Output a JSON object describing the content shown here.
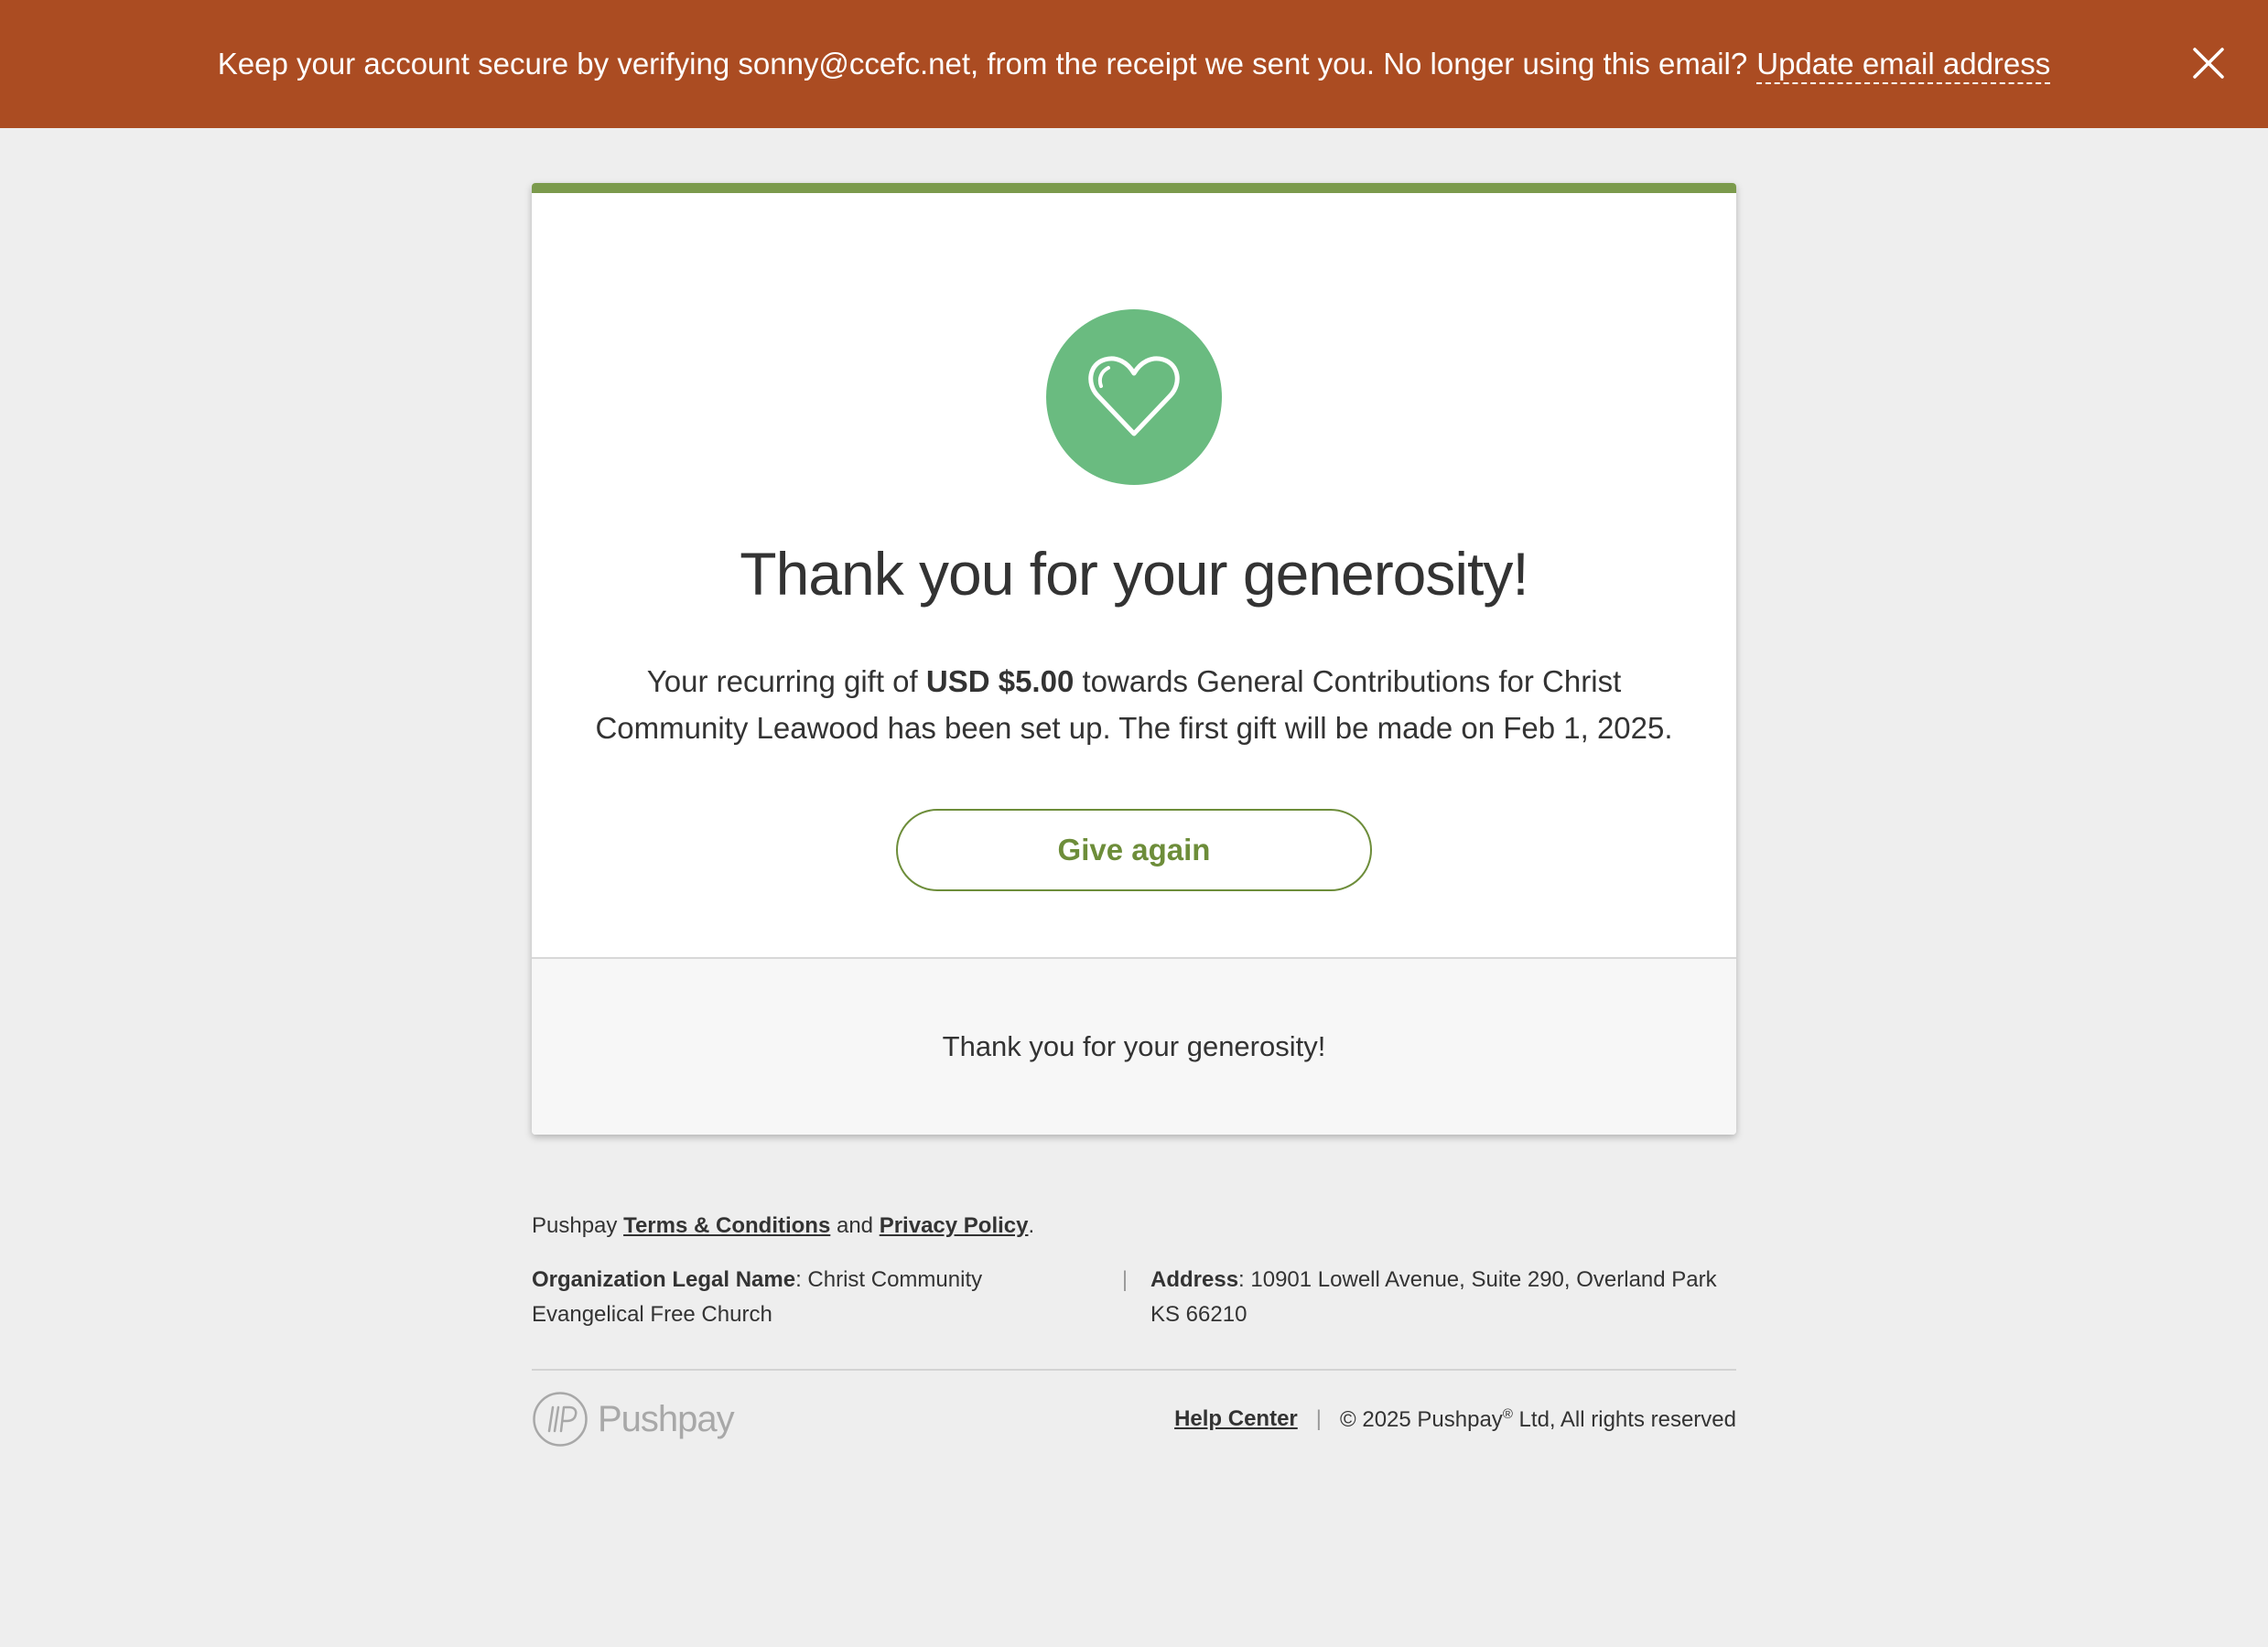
{
  "banner": {
    "message": "Keep your account secure by verifying sonny@ccefc.net, from the receipt we sent you. No longer using this email?",
    "link_label": "Update email address",
    "close_icon": "close-icon",
    "background": "#ab4c22"
  },
  "card": {
    "accent_color": "#7b9a4c",
    "icon": "heart-icon",
    "icon_color": "#6abb80",
    "title": "Thank you for your generosity!",
    "message_prefix": "Your recurring gift of",
    "amount": "USD $5.00",
    "message_suffix": "towards General Contributions for Christ Community Leawood has been set up. The first gift will be made on Feb 1, 2025.",
    "give_again_label": "Give again",
    "footer_message": "Thank you for your generosity!"
  },
  "footer": {
    "legal_prefix": "Pushpay",
    "terms_label": "Terms & Conditions",
    "legal_and": "and",
    "privacy_label": "Privacy Policy",
    "legal_end": ".",
    "org_name_label": "Organization Legal Name",
    "org_name_value": "Christ Community Evangelical Free Church",
    "separator": "|",
    "address_label": "Address",
    "address_value": "10901 Lowell Avenue, Suite 290, Overland Park KS 66210",
    "brand_name": "Pushpay",
    "brand_icon": "pushpay-logo-icon",
    "help_label": "Help Center",
    "copyright_prefix": "© 2025 Pushpay",
    "copyright_mark": "®",
    "copyright_suffix": "Ltd, All rights reserved"
  }
}
